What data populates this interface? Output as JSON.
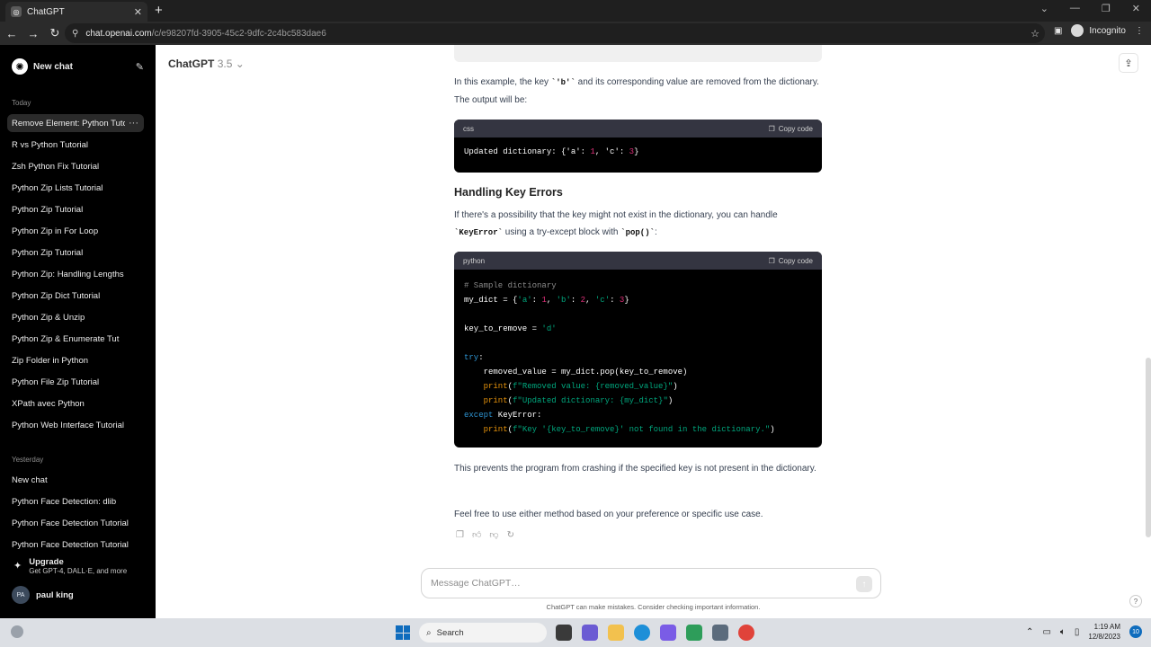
{
  "browser": {
    "tab_title": "ChatGPT",
    "tab_close": "✕",
    "new_tab": "+",
    "url_host": "chat.openai.com",
    "url_path": "/c/e98207fd-3905-45c2-9dfc-2c4bc583dae6",
    "profile": "Incognito"
  },
  "sidebar": {
    "new_chat": "New chat",
    "today_label": "Today",
    "today_items": [
      "Remove Element: Python Tuto",
      "R vs Python Tutorial",
      "Zsh Python Fix Tutorial",
      "Python Zip Lists Tutorial",
      "Python Zip Tutorial",
      "Python Zip in For Loop",
      "Python Zip Tutorial",
      "Python Zip: Handling Lengths",
      "Python Zip Dict Tutorial",
      "Python Zip & Unzip",
      "Python Zip & Enumerate Tut",
      "Zip Folder in Python",
      "Python File Zip Tutorial",
      "XPath avec Python",
      "Python Web Interface Tutorial"
    ],
    "active_item_menu": "···",
    "yesterday_label": "Yesterday",
    "yesterday_items": [
      "New chat",
      "Python Face Detection: dlib",
      "Python Face Detection Tutorial",
      "Python Face Detection Tutorial"
    ],
    "upgrade_title": "Upgrade",
    "upgrade_sub": "Get GPT-4, DALL·E, and more",
    "user_initials": "PA",
    "user_name": "paul king"
  },
  "header": {
    "model": "ChatGPT",
    "version": "3.5"
  },
  "message": {
    "p1_a": "In this example, the key ",
    "p1_code": "`'b'`",
    "p1_b": " and its corresponding value are removed from the dictionary. The output will be:",
    "code1_lang": "css",
    "copy_label": "Copy code",
    "heading": "Handling Key Errors",
    "p2_a": "If there's a possibility that the key might not exist in the dictionary, you can handle ",
    "p2_code1": "`KeyError`",
    "p2_b": " using a try-except block with ",
    "p2_code2": "`pop()`",
    "p2_c": ":",
    "code2_lang": "python",
    "p3": "This prevents the program from crashing if the specified key is not present in the dictionary.",
    "p4": "Feel free to use either method based on your preference or specific use case."
  },
  "composer": {
    "placeholder": "Message ChatGPT…",
    "disclaimer": "ChatGPT can make mistakes. Consider checking important information.",
    "help": "?"
  },
  "taskbar": {
    "search": "Search",
    "time": "1:19 AM",
    "date": "12/8/2023",
    "notifications": "10"
  },
  "colors": {
    "sidebar_bg": "#000000",
    "code_bg": "#000000",
    "code_header_bg": "#343541",
    "string": "#00a67d",
    "number": "#df3079",
    "keyword": "#2e95d3",
    "builtin": "#e9950c"
  }
}
